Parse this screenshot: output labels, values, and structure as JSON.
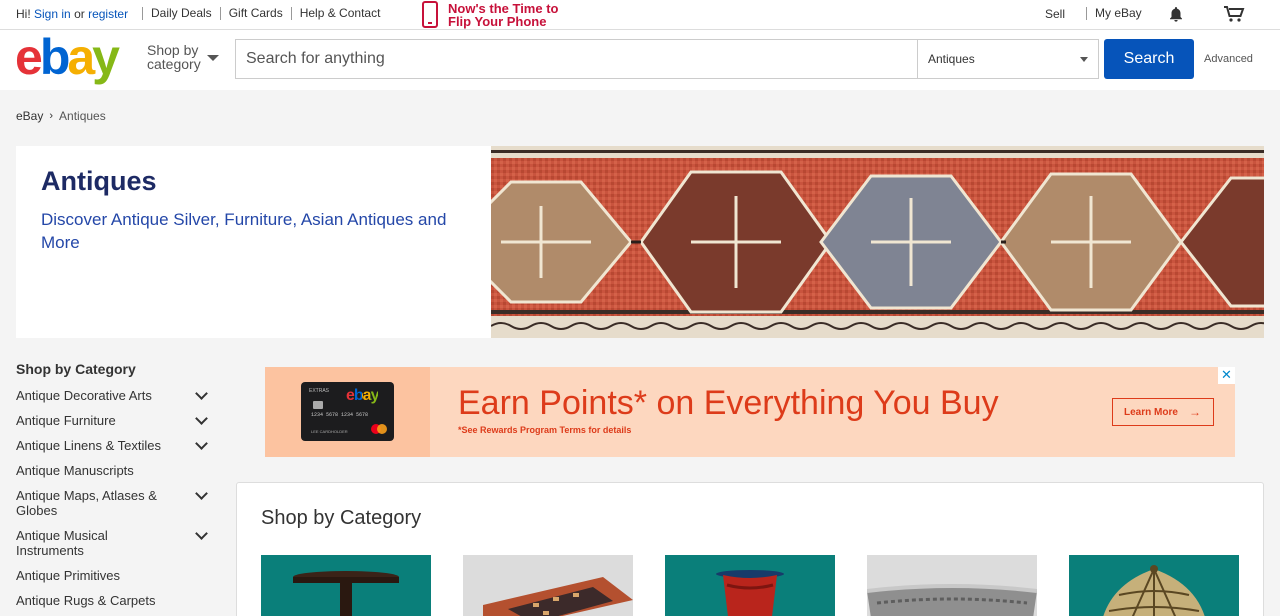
{
  "topbar": {
    "greeting_prefix": "Hi!",
    "sign_in": "Sign in",
    "or": "or",
    "register": "register",
    "links": [
      "Daily Deals",
      "Gift Cards",
      "Help & Contact"
    ],
    "promo_line1": "Now's the Time to",
    "promo_line2": "Flip Your Phone",
    "sell": "Sell",
    "my_ebay": "My eBay",
    "icons": [
      "phone-icon",
      "bell-icon",
      "cart-icon"
    ]
  },
  "header": {
    "logo": {
      "e": "e",
      "b": "b",
      "a": "a",
      "y": "y"
    },
    "shop_by_line1": "Shop by",
    "shop_by_line2": "category",
    "search_placeholder": "Search for anything",
    "search_value": "",
    "category_selected": "Antiques",
    "search_button": "Search",
    "advanced": "Advanced"
  },
  "breadcrumb": {
    "root": "eBay",
    "current": "Antiques"
  },
  "hero": {
    "title": "Antiques",
    "subtitle": "Discover Antique Silver, Furniture, Asian Antiques and More"
  },
  "sidebar": {
    "heading": "Shop by Category",
    "items": [
      {
        "label": "Antique Decorative Arts",
        "expandable": true
      },
      {
        "label": "Antique Furniture",
        "expandable": true
      },
      {
        "label": "Antique Linens & Textiles",
        "expandable": true
      },
      {
        "label": "Antique Manuscripts",
        "expandable": false
      },
      {
        "label": "Antique Maps, Atlases & Globes",
        "expandable": true
      },
      {
        "label": "Antique Musical Instruments",
        "expandable": true
      },
      {
        "label": "Antique Primitives",
        "expandable": false
      },
      {
        "label": "Antique Rugs & Carpets",
        "expandable": false
      }
    ]
  },
  "ad": {
    "card_extras": "EXTRAS",
    "card_logo": "ebay",
    "card_number": "1234 5678 1234 5678",
    "card_name": "LEE CARDHOLDER",
    "headline": "Earn Points* on Everything You Buy",
    "terms": "*See Rewards Program Terms for details",
    "cta": "Learn More",
    "close": "✕"
  },
  "category_panel": {
    "title": "Shop by Category"
  },
  "colors": {
    "link_blue": "#0654ba",
    "promo_red": "#c7113a",
    "hero_title": "#1d2a64",
    "hero_subtitle": "#2447a8",
    "ad_orange": "#dd3b1a",
    "tile_teal": "#0a7f7a"
  }
}
